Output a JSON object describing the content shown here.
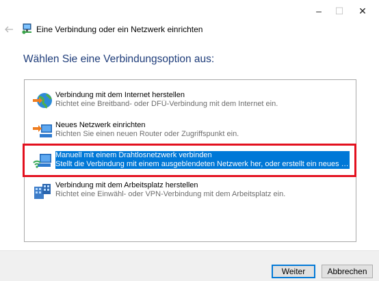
{
  "window": {
    "title": "Eine Verbindung oder ein Netzwerk einrichten",
    "caption_buttons": {
      "minimize": "–",
      "maximize": "☐",
      "close": "✕"
    }
  },
  "heading": "Wählen Sie eine Verbindungsoption aus:",
  "options": [
    {
      "icon": "internet-globe-icon",
      "title": "Verbindung mit dem Internet herstellen",
      "description": "Richtet eine Breitband- oder DFÜ-Verbindung mit dem Internet ein.",
      "selected": false
    },
    {
      "icon": "router-setup-icon",
      "title": "Neues Netzwerk einrichten",
      "description": "Richten Sie einen neuen Router oder Zugriffspunkt ein.",
      "selected": false
    },
    {
      "icon": "wireless-network-icon",
      "title": "Manuell mit einem Drahtlosnetzwerk verbinden",
      "description": "Stellt die Verbindung mit einem ausgeblendeten Netzwerk her, oder erstellt ein neues Dr...",
      "selected": true
    },
    {
      "icon": "workplace-connection-icon",
      "title": "Verbindung mit dem Arbeitsplatz herstellen",
      "description": "Richtet eine Einwähl- oder VPN-Verbindung mit dem Arbeitsplatz ein.",
      "selected": false
    }
  ],
  "footer": {
    "next_label": "Weiter",
    "cancel_label": "Abbrechen"
  },
  "colors": {
    "accent": "#0078d7",
    "heading": "#1f3d7a",
    "highlight_box": "#e3101e"
  }
}
